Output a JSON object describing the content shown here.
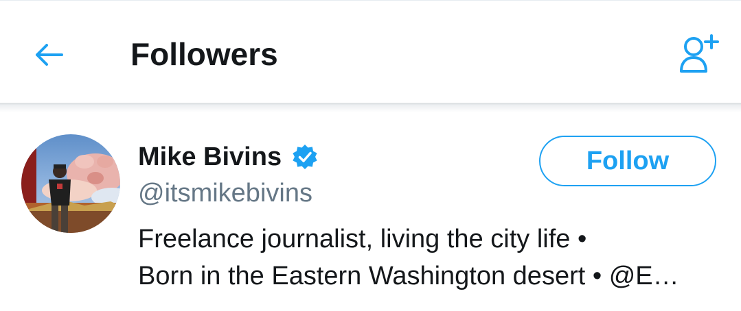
{
  "header": {
    "title": "Followers",
    "back_icon": "arrow-left-icon",
    "action_icon": "add-user-icon",
    "accent_color": "#1da1f2"
  },
  "followers": [
    {
      "name": "Mike Bivins",
      "handle": "@itsmikebivins",
      "verified": true,
      "verified_icon": "verified-badge-icon",
      "bio_line_1": "Freelance journalist, living the city life •",
      "bio_line_2": "Born in the Eastern Washington desert • @E…",
      "follow_label": "Follow"
    }
  ],
  "colors": {
    "text_primary": "#14171a",
    "text_secondary": "#657786",
    "accent": "#1da1f2"
  }
}
